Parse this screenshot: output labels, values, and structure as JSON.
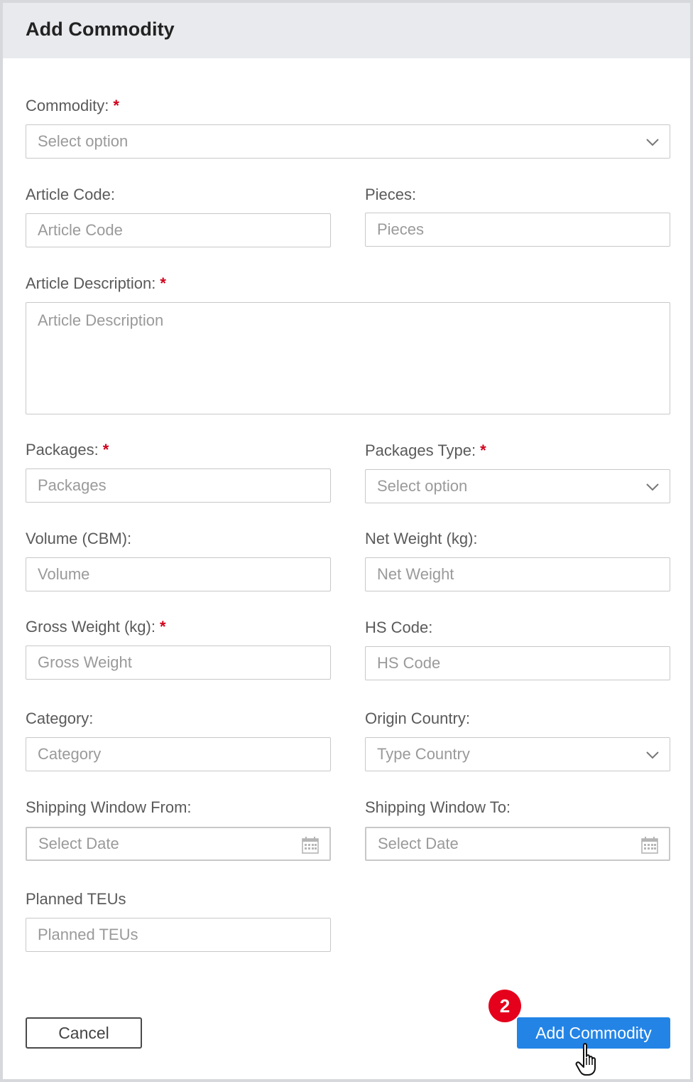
{
  "dialog": {
    "title": "Add Commodity"
  },
  "required_marker": "*",
  "fields": {
    "commodity": {
      "label": "Commodity:",
      "placeholder": "Select option",
      "required": true
    },
    "article_code": {
      "label": "Article Code:",
      "placeholder": "Article Code"
    },
    "pieces": {
      "label": "Pieces:",
      "placeholder": "Pieces"
    },
    "article_description": {
      "label": "Article Description:",
      "placeholder": "Article Description",
      "required": true
    },
    "packages": {
      "label": "Packages:",
      "placeholder": "Packages",
      "required": true
    },
    "packages_type": {
      "label": "Packages Type:",
      "placeholder": "Select option",
      "required": true
    },
    "volume": {
      "label": "Volume (CBM):",
      "placeholder": "Volume"
    },
    "net_weight": {
      "label": "Net Weight (kg):",
      "placeholder": "Net Weight"
    },
    "gross_weight": {
      "label": "Gross Weight (kg):",
      "placeholder": "Gross Weight",
      "required": true
    },
    "hs_code": {
      "label": "HS Code:",
      "placeholder": "HS Code"
    },
    "category": {
      "label": "Category:",
      "placeholder": "Category"
    },
    "origin_country": {
      "label": "Origin Country:",
      "placeholder": "Type Country"
    },
    "shipping_window_from": {
      "label": "Shipping Window From:",
      "placeholder": "Select Date"
    },
    "shipping_window_to": {
      "label": "Shipping Window To:",
      "placeholder": "Select Date"
    },
    "planned_teus": {
      "label": "Planned TEUs",
      "placeholder": "Planned TEUs"
    }
  },
  "actions": {
    "cancel_label": "Cancel",
    "add_label": "Add Commodity",
    "step_badge": "2"
  },
  "icons": {
    "dropdown": "chevron-down-icon",
    "date": "calendar-icon",
    "pointer": "hand-pointer-cursor-icon"
  },
  "colors": {
    "primary": "#2384e6",
    "required": "#d0021b",
    "badge": "#e5001c",
    "header_bg": "#e8eaed"
  }
}
